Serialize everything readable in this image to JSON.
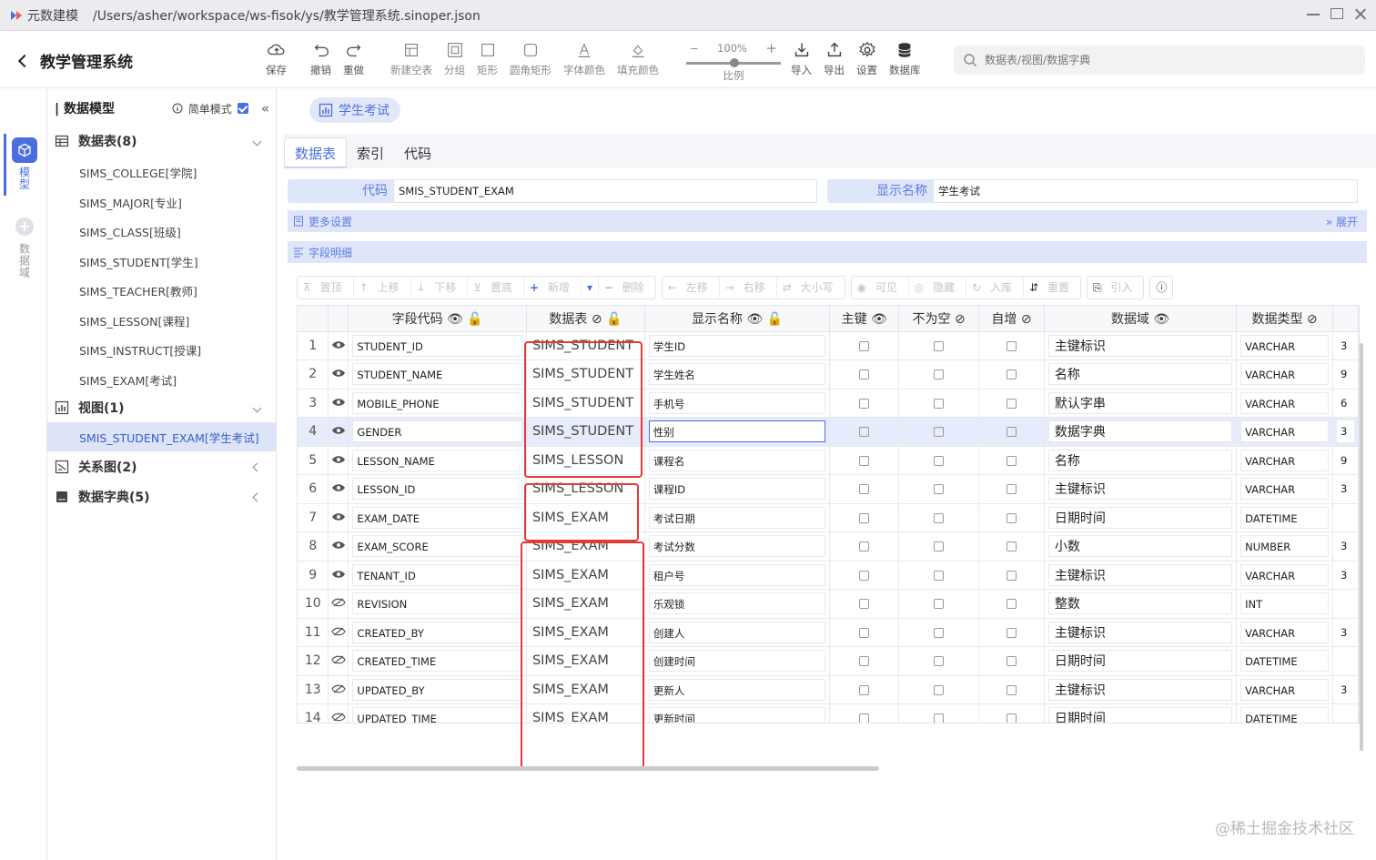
{
  "titlebar": {
    "app": "元数建模",
    "path": "/Users/asher/workspace/ws-fisok/ys/教学管理系统.sinoper.json"
  },
  "header": {
    "project": "教学管理系统",
    "tools": {
      "save": "保存",
      "undo": "撤销",
      "redo": "重做",
      "new_table": "新建空表",
      "group": "分组",
      "rect": "矩形",
      "round_rect": "圆角矩形",
      "font_color": "字体颜色",
      "fill_color": "填充颜色",
      "import": "导入",
      "export": "导出",
      "settings": "设置",
      "database": "数据库"
    },
    "zoom": {
      "value": "100%",
      "label": "比例"
    },
    "search_placeholder": "数据表/视图/数据字典"
  },
  "rail": {
    "model": "模型",
    "domain": "数据域"
  },
  "sidebar": {
    "title": "数据模型",
    "simple_mode": "简单模式",
    "tables_group": "数据表(8)",
    "tables": [
      "SIMS_COLLEGE[学院]",
      "SIMS_MAJOR[专业]",
      "SIMS_CLASS[班级]",
      "SIMS_STUDENT[学生]",
      "SIMS_TEACHER[教师]",
      "SIMS_LESSON[课程]",
      "SIMS_INSTRUCT[授课]",
      "SIMS_EXAM[考试]"
    ],
    "views_group": "视图(1)",
    "views": [
      "SMIS_STUDENT_EXAM[学生考试]"
    ],
    "relations_group": "关系图(2)",
    "dict_group": "数据字典(5)"
  },
  "doc_tab": "学生考试",
  "tabs": [
    "数据表",
    "索引",
    "代码"
  ],
  "form": {
    "code_label": "代码",
    "code_value": "SMIS_STUDENT_EXAM",
    "name_label": "显示名称",
    "name_value": "学生考试"
  },
  "more_settings": {
    "label": "更多设置",
    "expand": "展开"
  },
  "field_detail": "字段明细",
  "toolbar": {
    "top": "置顶",
    "up": "上移",
    "down": "下移",
    "bottom": "置底",
    "add": "新增",
    "delete": "删除",
    "left": "左移",
    "right": "右移",
    "case": "大小写",
    "visible": "可见",
    "hidden": "隐藏",
    "store": "入库",
    "reset": "重置",
    "ref": "引入"
  },
  "columns": [
    "字段代码",
    "数据表",
    "显示名称",
    "主键",
    "不为空",
    "自增",
    "数据域",
    "数据类型"
  ],
  "rows": [
    {
      "n": "1",
      "code": "STUDENT_ID",
      "table": "SIMS_STUDENT",
      "name": "学生ID",
      "domain": "主键标识",
      "type": "VARCHAR",
      "len": "3"
    },
    {
      "n": "2",
      "code": "STUDENT_NAME",
      "table": "SIMS_STUDENT",
      "name": "学生姓名",
      "domain": "名称",
      "type": "VARCHAR",
      "len": "9"
    },
    {
      "n": "3",
      "code": "MOBILE_PHONE",
      "table": "SIMS_STUDENT",
      "name": "手机号",
      "domain": "默认字串",
      "type": "VARCHAR",
      "len": "6"
    },
    {
      "n": "4",
      "code": "GENDER",
      "table": "SIMS_STUDENT",
      "name": "性别",
      "domain": "数据字典",
      "type": "VARCHAR",
      "len": "3"
    },
    {
      "n": "5",
      "code": "LESSON_NAME",
      "table": "SIMS_LESSON",
      "name": "课程名",
      "domain": "名称",
      "type": "VARCHAR",
      "len": "9"
    },
    {
      "n": "6",
      "code": "LESSON_ID",
      "table": "SIMS_LESSON",
      "name": "课程ID",
      "domain": "主键标识",
      "type": "VARCHAR",
      "len": "3"
    },
    {
      "n": "7",
      "code": "EXAM_DATE",
      "table": "SIMS_EXAM",
      "name": "考试日期",
      "domain": "日期时间",
      "type": "DATETIME",
      "len": ""
    },
    {
      "n": "8",
      "code": "EXAM_SCORE",
      "table": "SIMS_EXAM",
      "name": "考试分数",
      "domain": "小数",
      "type": "NUMBER",
      "len": "3"
    },
    {
      "n": "9",
      "code": "TENANT_ID",
      "table": "SIMS_EXAM",
      "name": "租户号",
      "domain": "主键标识",
      "type": "VARCHAR",
      "len": "3"
    },
    {
      "n": "10",
      "code": "REVISION",
      "table": "SIMS_EXAM",
      "name": "乐观锁",
      "domain": "整数",
      "type": "INT",
      "len": ""
    },
    {
      "n": "11",
      "code": "CREATED_BY",
      "table": "SIMS_EXAM",
      "name": "创建人",
      "domain": "主键标识",
      "type": "VARCHAR",
      "len": "3"
    },
    {
      "n": "12",
      "code": "CREATED_TIME",
      "table": "SIMS_EXAM",
      "name": "创建时间",
      "domain": "日期时间",
      "type": "DATETIME",
      "len": ""
    },
    {
      "n": "13",
      "code": "UPDATED_BY",
      "table": "SIMS_EXAM",
      "name": "更新人",
      "domain": "主键标识",
      "type": "VARCHAR",
      "len": "3"
    },
    {
      "n": "14",
      "code": "UPDATED_TIME",
      "table": "SIMS_EXAM",
      "name": "更新时间",
      "domain": "日期时间",
      "type": "DATETIME",
      "len": ""
    }
  ],
  "watermark": "@稀土掘金技术社区",
  "colors": {
    "accent": "#4a6ee0",
    "highlight": "#e53935"
  }
}
